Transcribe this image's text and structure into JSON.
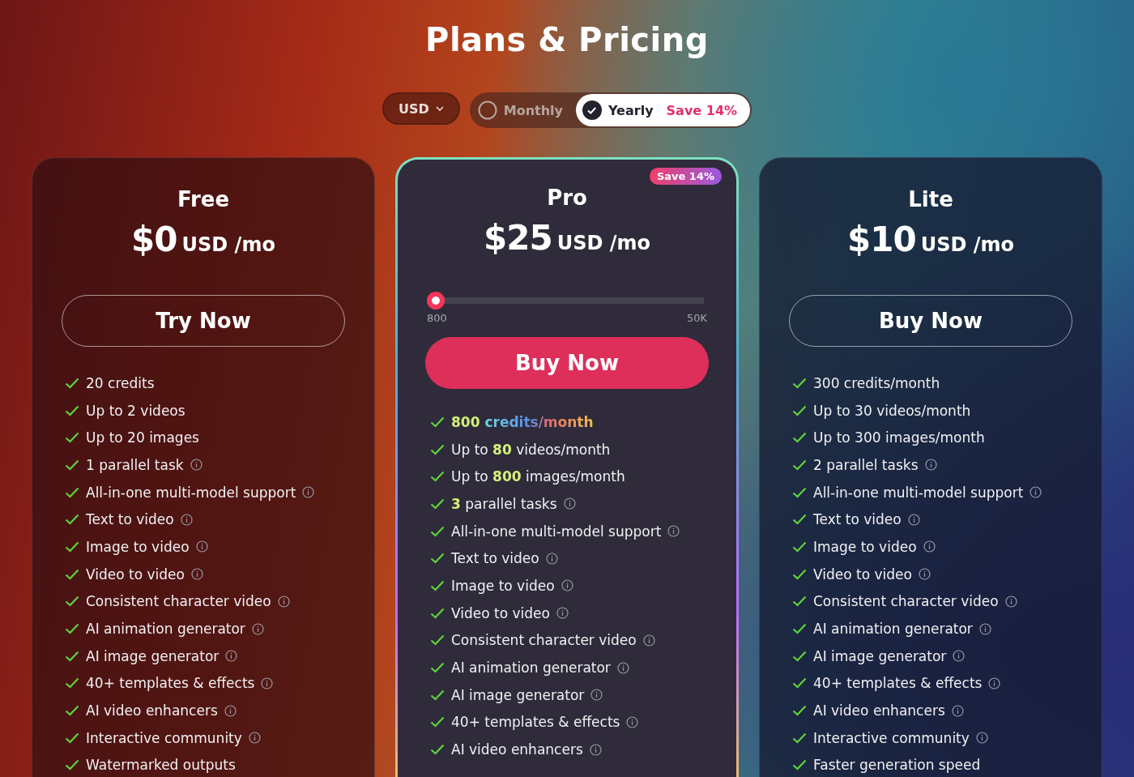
{
  "title": "Plans & Pricing",
  "currency": {
    "label": "USD"
  },
  "billing": [
    {
      "label": "Monthly",
      "selected": false
    },
    {
      "label": "Yearly",
      "selected": true,
      "badge": "Save 14%"
    }
  ],
  "plans": [
    {
      "name": "Free",
      "price": "$0",
      "unit": "USD /mo",
      "button": {
        "label": "Try Now",
        "kind": "outline"
      },
      "features": [
        {
          "parts": [
            {
              "text": "20 credits",
              "kind": "plain"
            }
          ],
          "info": false
        },
        {
          "parts": [
            {
              "text": "Up to 2 videos",
              "kind": "plain"
            }
          ],
          "info": false
        },
        {
          "parts": [
            {
              "text": "Up to 20 images",
              "kind": "plain"
            }
          ],
          "info": false
        },
        {
          "parts": [
            {
              "text": "1 parallel task",
              "kind": "plain"
            }
          ],
          "info": true
        },
        {
          "parts": [
            {
              "text": "All-in-one multi-model support",
              "kind": "plain"
            }
          ],
          "info": true
        },
        {
          "parts": [
            {
              "text": "Text to video",
              "kind": "plain"
            }
          ],
          "info": true
        },
        {
          "parts": [
            {
              "text": "Image to video",
              "kind": "plain"
            }
          ],
          "info": true
        },
        {
          "parts": [
            {
              "text": "Video to video",
              "kind": "plain"
            }
          ],
          "info": true
        },
        {
          "parts": [
            {
              "text": "Consistent character video",
              "kind": "plain"
            }
          ],
          "info": true
        },
        {
          "parts": [
            {
              "text": "AI animation generator",
              "kind": "plain"
            }
          ],
          "info": true
        },
        {
          "parts": [
            {
              "text": "AI image generator",
              "kind": "plain"
            }
          ],
          "info": true
        },
        {
          "parts": [
            {
              "text": "40+ templates & effects",
              "kind": "plain"
            }
          ],
          "info": true
        },
        {
          "parts": [
            {
              "text": "AI video enhancers",
              "kind": "plain"
            }
          ],
          "info": true
        },
        {
          "parts": [
            {
              "text": "Interactive community",
              "kind": "plain"
            }
          ],
          "info": true
        },
        {
          "parts": [
            {
              "text": "Watermarked outputs",
              "kind": "plain"
            }
          ],
          "info": false
        }
      ]
    },
    {
      "name": "Pro",
      "price": "$25",
      "unit": "USD /mo",
      "badge": "Save 14%",
      "slider": {
        "level": 0,
        "min": "800",
        "max": "50K"
      },
      "button": {
        "label": "Buy Now",
        "kind": "filled"
      },
      "features": [
        {
          "parts": [
            {
              "text": "800",
              "kind": "number"
            },
            {
              "text": " credits/month",
              "kind": "gradient"
            }
          ],
          "info": false
        },
        {
          "parts": [
            {
              "text": "Up to ",
              "kind": "plain"
            },
            {
              "text": "80",
              "kind": "number"
            },
            {
              "text": " videos/month",
              "kind": "plain"
            }
          ],
          "info": false
        },
        {
          "parts": [
            {
              "text": "Up to ",
              "kind": "plain"
            },
            {
              "text": "800",
              "kind": "number"
            },
            {
              "text": " images/month",
              "kind": "plain"
            }
          ],
          "info": false
        },
        {
          "parts": [
            {
              "text": "3",
              "kind": "number"
            },
            {
              "text": " parallel tasks",
              "kind": "plain"
            }
          ],
          "info": true
        },
        {
          "parts": [
            {
              "text": "All-in-one multi-model support",
              "kind": "plain"
            }
          ],
          "info": true
        },
        {
          "parts": [
            {
              "text": "Text to video",
              "kind": "plain"
            }
          ],
          "info": true
        },
        {
          "parts": [
            {
              "text": "Image to video",
              "kind": "plain"
            }
          ],
          "info": true
        },
        {
          "parts": [
            {
              "text": "Video to video",
              "kind": "plain"
            }
          ],
          "info": true
        },
        {
          "parts": [
            {
              "text": "Consistent character video",
              "kind": "plain"
            }
          ],
          "info": true
        },
        {
          "parts": [
            {
              "text": "AI animation generator",
              "kind": "plain"
            }
          ],
          "info": true
        },
        {
          "parts": [
            {
              "text": "AI image generator",
              "kind": "plain"
            }
          ],
          "info": true
        },
        {
          "parts": [
            {
              "text": "40+ templates & effects",
              "kind": "plain"
            }
          ],
          "info": true
        },
        {
          "parts": [
            {
              "text": "AI video enhancers",
              "kind": "plain"
            }
          ],
          "info": true
        }
      ]
    },
    {
      "name": "Lite",
      "price": "$10",
      "unit": "USD /mo",
      "button": {
        "label": "Buy Now",
        "kind": "outline"
      },
      "features": [
        {
          "parts": [
            {
              "text": "300 credits/month",
              "kind": "plain"
            }
          ],
          "info": false
        },
        {
          "parts": [
            {
              "text": "Up to 30 videos/month",
              "kind": "plain"
            }
          ],
          "info": false
        },
        {
          "parts": [
            {
              "text": "Up to 300 images/month",
              "kind": "plain"
            }
          ],
          "info": false
        },
        {
          "parts": [
            {
              "text": "2 parallel tasks",
              "kind": "plain"
            }
          ],
          "info": true
        },
        {
          "parts": [
            {
              "text": "All-in-one multi-model support",
              "kind": "plain"
            }
          ],
          "info": true
        },
        {
          "parts": [
            {
              "text": "Text to video",
              "kind": "plain"
            }
          ],
          "info": true
        },
        {
          "parts": [
            {
              "text": "Image to video",
              "kind": "plain"
            }
          ],
          "info": true
        },
        {
          "parts": [
            {
              "text": "Video to video",
              "kind": "plain"
            }
          ],
          "info": true
        },
        {
          "parts": [
            {
              "text": "Consistent character video",
              "kind": "plain"
            }
          ],
          "info": true
        },
        {
          "parts": [
            {
              "text": "AI animation generator",
              "kind": "plain"
            }
          ],
          "info": true
        },
        {
          "parts": [
            {
              "text": "AI image generator",
              "kind": "plain"
            }
          ],
          "info": true
        },
        {
          "parts": [
            {
              "text": "40+ templates & effects",
              "kind": "plain"
            }
          ],
          "info": true
        },
        {
          "parts": [
            {
              "text": "AI video enhancers",
              "kind": "plain"
            }
          ],
          "info": true
        },
        {
          "parts": [
            {
              "text": "Interactive community",
              "kind": "plain"
            }
          ],
          "info": true
        },
        {
          "parts": [
            {
              "text": "Faster generation speed",
              "kind": "plain"
            }
          ],
          "info": false
        }
      ]
    }
  ]
}
